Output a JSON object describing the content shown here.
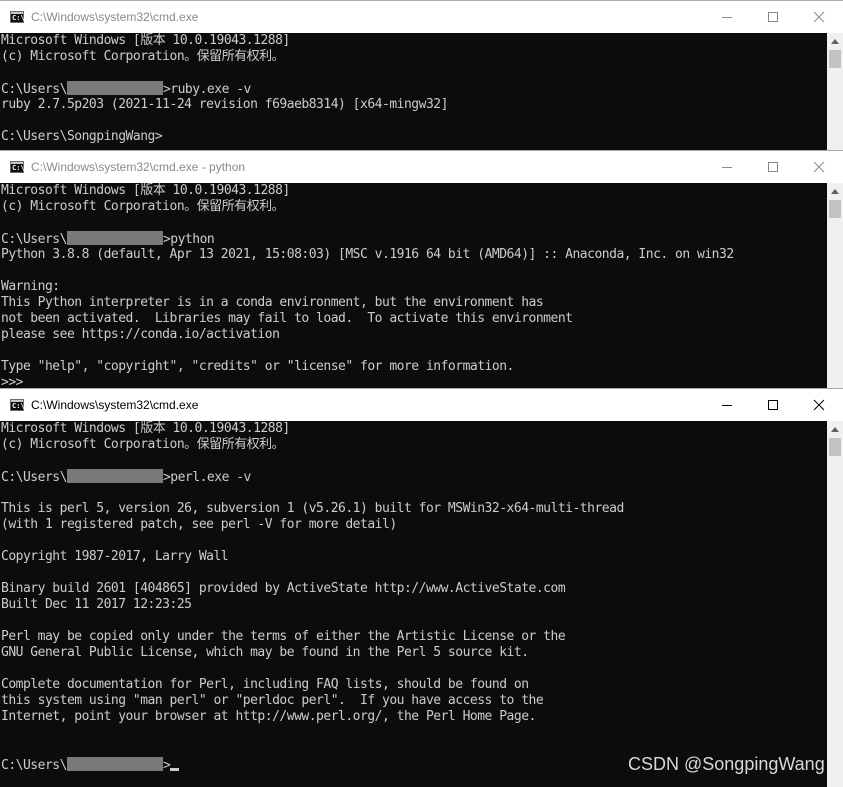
{
  "windows": [
    {
      "title": "C:\\Windows\\system32\\cmd.exe",
      "icon": "cmd-icon",
      "lines": [
        "Microsoft Windows [版本 10.0.19043.1288]",
        "(c) Microsoft Corporation。保留所有权利。",
        "",
        {
          "pre": "C:\\Users\\",
          "redacted": true,
          "post": ">ruby.exe -v"
        },
        "ruby 2.7.5p203 (2021-11-24 revision f69aeb8314) [x64-mingw32]",
        "",
        "C:\\Users\\SongpingWang>"
      ]
    },
    {
      "title": "C:\\Windows\\system32\\cmd.exe - python",
      "icon": "cmd-icon",
      "lines": [
        "Microsoft Windows [版本 10.0.19043.1288]",
        "(c) Microsoft Corporation。保留所有权利。",
        "",
        {
          "pre": "C:\\Users\\",
          "redacted": true,
          "post": ">python"
        },
        "Python 3.8.8 (default, Apr 13 2021, 15:08:03) [MSC v.1916 64 bit (AMD64)] :: Anaconda, Inc. on win32",
        "",
        "Warning:",
        "This Python interpreter is in a conda environment, but the environment has",
        "not been activated.  Libraries may fail to load.  To activate this environment",
        "please see https://conda.io/activation",
        "",
        "Type \"help\", \"copyright\", \"credits\" or \"license\" for more information.",
        ">>>"
      ]
    },
    {
      "title": "C:\\Windows\\system32\\cmd.exe",
      "icon": "cmd-icon",
      "lines": [
        "Microsoft Windows [版本 10.0.19043.1288]",
        "(c) Microsoft Corporation。保留所有权利。",
        "",
        {
          "pre": "C:\\Users\\",
          "redacted": true,
          "post": ">perl.exe -v"
        },
        "",
        "This is perl 5, version 26, subversion 1 (v5.26.1) built for MSWin32-x64-multi-thread",
        "(with 1 registered patch, see perl -V for more detail)",
        "",
        "Copyright 1987-2017, Larry Wall",
        "",
        "Binary build 2601 [404865] provided by ActiveState http://www.ActiveState.com",
        "Built Dec 11 2017 12:23:25",
        "",
        "Perl may be copied only under the terms of either the Artistic License or the",
        "GNU General Public License, which may be found in the Perl 5 source kit.",
        "",
        "Complete documentation for Perl, including FAQ lists, should be found on",
        "this system using \"man perl\" or \"perldoc perl\".  If you have access to the",
        "Internet, point your browser at http://www.perl.org/, the Perl Home Page.",
        "",
        "",
        {
          "pre": "C:\\Users\\",
          "redacted": true,
          "post": ">",
          "cursor": true
        }
      ]
    }
  ],
  "watermark": "CSDN @SongpingWang"
}
